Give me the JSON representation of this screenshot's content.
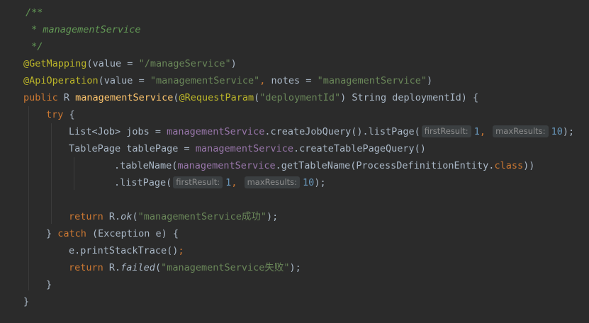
{
  "colors": {
    "background": "#2b2b2b",
    "default": "#a9b7c6",
    "keyword": "#cc7832",
    "annotation": "#bbb529",
    "string": "#6a8759",
    "comment": "#629755",
    "field": "#9876aa",
    "method": "#ffc66d",
    "number": "#6897bb",
    "hint_bg": "#3b3f41",
    "hint_fg": "#8c8c8c",
    "guide": "#3b3b3b"
  },
  "lines": [
    {
      "indent": 36,
      "tokens": [
        {
          "t": "/**",
          "c": "comment",
          "i": true
        }
      ]
    },
    {
      "indent": 36,
      "tokens": [
        {
          "t": " * managementService",
          "c": "comment",
          "i": true
        }
      ]
    },
    {
      "indent": 36,
      "tokens": [
        {
          "t": " */",
          "c": "comment",
          "i": true
        }
      ]
    },
    {
      "indent": 33,
      "tokens": [
        {
          "t": "@GetMapping",
          "c": "annotation"
        },
        {
          "t": "(value = ",
          "c": "default"
        },
        {
          "t": "\"/manageService\"",
          "c": "string"
        },
        {
          "t": ")",
          "c": "default"
        }
      ]
    },
    {
      "indent": 33,
      "tokens": [
        {
          "t": "@ApiOperation",
          "c": "annotation"
        },
        {
          "t": "(value = ",
          "c": "default"
        },
        {
          "t": "\"managementService\"",
          "c": "string"
        },
        {
          "t": ", ",
          "c": "keyword"
        },
        {
          "t": "notes = ",
          "c": "default"
        },
        {
          "t": "\"managementService\"",
          "c": "string"
        },
        {
          "t": ")",
          "c": "default"
        }
      ]
    },
    {
      "indent": 33,
      "tokens": [
        {
          "t": "public ",
          "c": "keyword"
        },
        {
          "t": "R ",
          "c": "default"
        },
        {
          "t": "managementService",
          "c": "method"
        },
        {
          "t": "(",
          "c": "default"
        },
        {
          "t": "@RequestParam",
          "c": "annotation"
        },
        {
          "t": "(",
          "c": "default"
        },
        {
          "t": "\"deploymentId\"",
          "c": "string"
        },
        {
          "t": ") String deploymentId) {",
          "c": "default"
        }
      ]
    },
    {
      "indent": 65,
      "tokens": [
        {
          "t": "try ",
          "c": "keyword"
        },
        {
          "t": "{",
          "c": "default"
        }
      ]
    },
    {
      "indent": 97,
      "tokens": [
        {
          "t": "List<Job> jobs = ",
          "c": "default"
        },
        {
          "t": "managementService",
          "c": "field"
        },
        {
          "t": ".createJobQuery().listPage(",
          "c": "default"
        },
        {
          "h": "firstResult:"
        },
        {
          "t": "1",
          "c": "number"
        },
        {
          "t": ", ",
          "c": "keyword"
        },
        {
          "h": "maxResults:"
        },
        {
          "t": "10",
          "c": "number"
        },
        {
          "t": ");",
          "c": "default"
        }
      ]
    },
    {
      "indent": 97,
      "tokens": [
        {
          "t": "TablePage tablePage = ",
          "c": "default"
        },
        {
          "t": "managementService",
          "c": "field"
        },
        {
          "t": ".createTablePageQuery()",
          "c": "default"
        }
      ]
    },
    {
      "indent": 161,
      "tokens": [
        {
          "t": ".tableName(",
          "c": "default"
        },
        {
          "t": "managementService",
          "c": "field"
        },
        {
          "t": ".getTableName(ProcessDefinitionEntity.",
          "c": "default"
        },
        {
          "t": "class",
          "c": "keyword"
        },
        {
          "t": "))",
          "c": "default"
        }
      ]
    },
    {
      "indent": 161,
      "tokens": [
        {
          "t": ".listPage(",
          "c": "default"
        },
        {
          "h": "firstResult:"
        },
        {
          "t": "1",
          "c": "number"
        },
        {
          "t": ", ",
          "c": "keyword"
        },
        {
          "h": "maxResults:"
        },
        {
          "t": "10",
          "c": "number"
        },
        {
          "t": ");",
          "c": "default"
        }
      ]
    },
    {
      "indent": 97,
      "tokens": []
    },
    {
      "indent": 97,
      "tokens": [
        {
          "t": "return ",
          "c": "keyword"
        },
        {
          "t": "R.",
          "c": "default"
        },
        {
          "t": "ok",
          "c": "default",
          "i": true
        },
        {
          "t": "(",
          "c": "default"
        },
        {
          "t": "\"managementService成功\"",
          "c": "string"
        },
        {
          "t": ");",
          "c": "default"
        }
      ]
    },
    {
      "indent": 65,
      "tokens": [
        {
          "t": "} ",
          "c": "default"
        },
        {
          "t": "catch ",
          "c": "keyword"
        },
        {
          "t": "(Exception e) {",
          "c": "default"
        }
      ]
    },
    {
      "indent": 97,
      "tokens": [
        {
          "t": "e.printStackTrace()",
          "c": "default"
        },
        {
          "t": ";",
          "c": "keyword"
        }
      ]
    },
    {
      "indent": 97,
      "tokens": [
        {
          "t": "return ",
          "c": "keyword"
        },
        {
          "t": "R.",
          "c": "default"
        },
        {
          "t": "failed",
          "c": "default",
          "i": true
        },
        {
          "t": "(",
          "c": "default"
        },
        {
          "t": "\"managementService失败\"",
          "c": "string"
        },
        {
          "t": ");",
          "c": "default"
        }
      ]
    },
    {
      "indent": 65,
      "tokens": [
        {
          "t": "}",
          "c": "default"
        }
      ]
    },
    {
      "indent": 33,
      "tokens": [
        {
          "t": "}",
          "c": "default"
        }
      ]
    }
  ]
}
